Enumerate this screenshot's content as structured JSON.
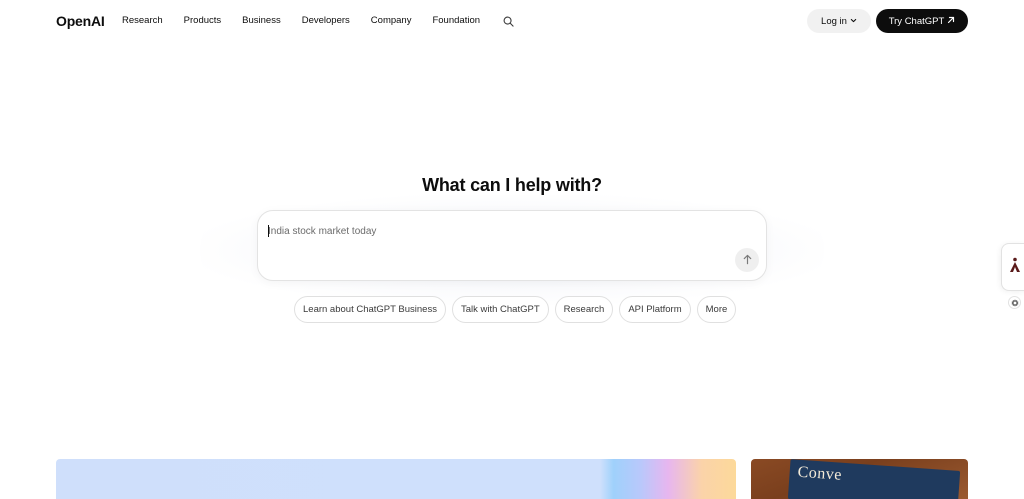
{
  "header": {
    "logo": "OpenAI",
    "nav": [
      {
        "label": "Research"
      },
      {
        "label": "Products"
      },
      {
        "label": "Business"
      },
      {
        "label": "Developers"
      },
      {
        "label": "Company"
      },
      {
        "label": "Foundation"
      }
    ],
    "search_icon": "search-icon",
    "login_label": "Log in",
    "try_label": "Try ChatGPT"
  },
  "hero": {
    "title": "What can I help with?",
    "prompt_placeholder": "India stock market today",
    "send_icon": "arrow-up-icon"
  },
  "chips": [
    {
      "label": "Learn about ChatGPT Business"
    },
    {
      "label": "Talk with ChatGPT"
    },
    {
      "label": "Research"
    },
    {
      "label": "API Platform"
    },
    {
      "label": "More"
    }
  ],
  "cards": {
    "right_book_title": "Conve"
  },
  "colors": {
    "text": "#0d0d0d",
    "button_dark": "#0d0d0d",
    "button_light": "#f1f1f1",
    "chip_border": "#e0e0e0",
    "widget_accent": "#5a1a1a"
  }
}
